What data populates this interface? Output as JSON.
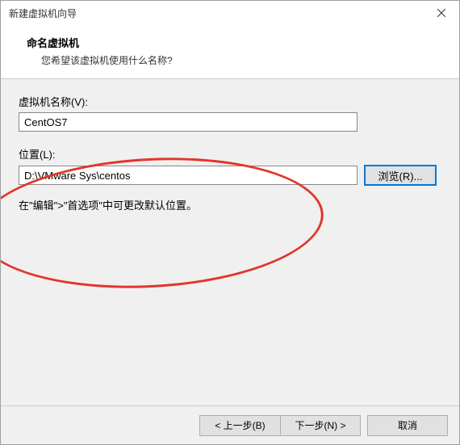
{
  "window": {
    "title": "新建虚拟机向导"
  },
  "header": {
    "heading": "命名虚拟机",
    "sub": "您希望该虚拟机使用什么名称?"
  },
  "form": {
    "name_label": "虚拟机名称(V):",
    "name_value": "CentOS7",
    "location_label": "位置(L):",
    "location_value": "D:\\VMware Sys\\centos",
    "browse_label": "浏览(R)...",
    "hint": "在\"编辑\">\"首选项\"中可更改默认位置。"
  },
  "footer": {
    "back": "< 上一步(B)",
    "next": "下一步(N) >",
    "cancel": "取消"
  }
}
